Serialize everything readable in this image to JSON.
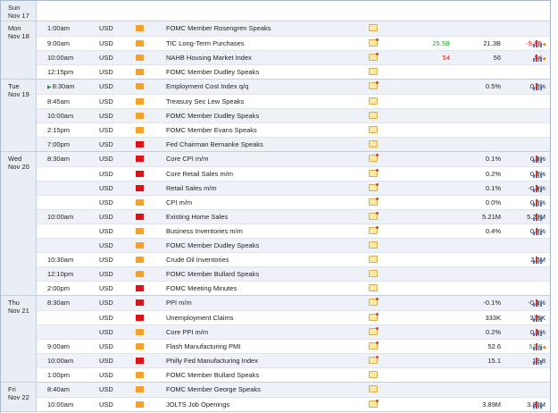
{
  "calendar": {
    "groups": [
      {
        "day": [
          "Sun",
          "Nov 17"
        ],
        "rows": []
      },
      {
        "day": [
          "Mon",
          "Nov 18"
        ],
        "rows": [
          {
            "time": "1:00am",
            "cur": "USD",
            "imp": "low",
            "event": "FOMC Member Rosengren Speaks",
            "doc": "plain",
            "actual": "",
            "actual_color": "",
            "forecast": "",
            "previous": "",
            "prev_color": "",
            "prev_mark": "",
            "chart": false
          },
          {
            "time": "9:00am",
            "cur": "USD",
            "imp": "low",
            "event": "TIC Long-Term Purchases",
            "doc": "star",
            "actual": "25.5B",
            "actual_color": "g",
            "forecast": "21.3B",
            "previous": "-9.8B",
            "prev_color": "r",
            "prev_mark": "◀",
            "chart": true
          },
          {
            "time": "10:00am",
            "cur": "USD",
            "imp": "low",
            "event": "NAHB Housing Market Index",
            "doc": "star",
            "actual": "54",
            "actual_color": "r",
            "forecast": "56",
            "previous": "54",
            "prev_color": "r",
            "prev_mark": "◀",
            "chart": true
          },
          {
            "time": "12:15pm",
            "cur": "USD",
            "imp": "low",
            "event": "FOMC Member Dudley Speaks",
            "doc": "plain",
            "actual": "",
            "actual_color": "",
            "forecast": "",
            "previous": "",
            "prev_color": "",
            "prev_mark": "",
            "chart": false
          }
        ]
      },
      {
        "day": [
          "Tue",
          "Nov 19"
        ],
        "rows": [
          {
            "time": "8:30am",
            "live": true,
            "cur": "USD",
            "imp": "low",
            "event": "Employment Cost Index q/q",
            "doc": "star",
            "actual": "",
            "actual_color": "",
            "forecast": "0.5%",
            "previous": "0.5%",
            "prev_color": "",
            "prev_mark": "",
            "chart": true
          },
          {
            "time": "8:45am",
            "cur": "USD",
            "imp": "low",
            "event": "Treasury Sec Lew Speaks",
            "doc": "plain",
            "actual": "",
            "actual_color": "",
            "forecast": "",
            "previous": "",
            "prev_color": "",
            "prev_mark": "",
            "chart": false
          },
          {
            "time": "10:00am",
            "cur": "USD",
            "imp": "low",
            "event": "FOMC Member Dudley Speaks",
            "doc": "plain",
            "actual": "",
            "actual_color": "",
            "forecast": "",
            "previous": "",
            "prev_color": "",
            "prev_mark": "",
            "chart": false
          },
          {
            "time": "2:15pm",
            "cur": "USD",
            "imp": "low",
            "event": "FOMC Member Evans Speaks",
            "doc": "plain",
            "actual": "",
            "actual_color": "",
            "forecast": "",
            "previous": "",
            "prev_color": "",
            "prev_mark": "",
            "chart": false
          },
          {
            "time": "7:00pm",
            "cur": "USD",
            "imp": "high",
            "event": "Fed Chairman Bernanke Speaks",
            "doc": "plain",
            "actual": "",
            "actual_color": "",
            "forecast": "",
            "previous": "",
            "prev_color": "",
            "prev_mark": "",
            "chart": false
          }
        ]
      },
      {
        "day": [
          "Wed",
          "Nov 20"
        ],
        "rows": [
          {
            "time": "8:30am",
            "cur": "USD",
            "imp": "high",
            "event": "Core CPI m/m",
            "doc": "star",
            "actual": "",
            "actual_color": "",
            "forecast": "0.1%",
            "previous": "0.1%",
            "prev_color": "",
            "prev_mark": "",
            "chart": true
          },
          {
            "time": "",
            "cur": "USD",
            "imp": "high",
            "event": "Core Retail Sales m/m",
            "doc": "star",
            "actual": "",
            "actual_color": "",
            "forecast": "0.2%",
            "previous": "0.4%",
            "prev_color": "",
            "prev_mark": "",
            "chart": true
          },
          {
            "time": "",
            "cur": "USD",
            "imp": "high",
            "event": "Retail Sales m/m",
            "doc": "star",
            "actual": "",
            "actual_color": "",
            "forecast": "0.1%",
            "previous": "-0.1%",
            "prev_color": "",
            "prev_mark": "",
            "chart": true
          },
          {
            "time": "",
            "cur": "USD",
            "imp": "low",
            "event": "CPI m/m",
            "doc": "star",
            "actual": "",
            "actual_color": "",
            "forecast": "0.0%",
            "previous": "0.2%",
            "prev_color": "",
            "prev_mark": "",
            "chart": true
          },
          {
            "time": "10:00am",
            "cur": "USD",
            "imp": "high",
            "event": "Existing Home Sales",
            "doc": "star",
            "actual": "",
            "actual_color": "",
            "forecast": "5.21M",
            "previous": "5.29M",
            "prev_color": "",
            "prev_mark": "",
            "chart": true
          },
          {
            "time": "",
            "cur": "USD",
            "imp": "low",
            "event": "Business Inventories m/m",
            "doc": "star",
            "actual": "",
            "actual_color": "",
            "forecast": "0.4%",
            "previous": "0.3%",
            "prev_color": "",
            "prev_mark": "",
            "chart": true
          },
          {
            "time": "",
            "cur": "USD",
            "imp": "low",
            "event": "FOMC Member Dudley Speaks",
            "doc": "plain",
            "actual": "",
            "actual_color": "",
            "forecast": "",
            "previous": "",
            "prev_color": "",
            "prev_mark": "",
            "chart": false
          },
          {
            "time": "10:30am",
            "cur": "USD",
            "imp": "low",
            "event": "Crude Oil Inventories",
            "doc": "plain",
            "actual": "",
            "actual_color": "",
            "forecast": "",
            "previous": "2.6M",
            "prev_color": "",
            "prev_mark": "",
            "chart": true
          },
          {
            "time": "12:10pm",
            "cur": "USD",
            "imp": "low",
            "event": "FOMC Member Bullard Speaks",
            "doc": "plain",
            "actual": "",
            "actual_color": "",
            "forecast": "",
            "previous": "",
            "prev_color": "",
            "prev_mark": "",
            "chart": false
          },
          {
            "time": "2:00pm",
            "cur": "USD",
            "imp": "high",
            "event": "FOMC Meeting Minutes",
            "doc": "plain",
            "actual": "",
            "actual_color": "",
            "forecast": "",
            "previous": "",
            "prev_color": "",
            "prev_mark": "",
            "chart": false
          }
        ]
      },
      {
        "day": [
          "Thu",
          "Nov 21"
        ],
        "rows": [
          {
            "time": "8:30am",
            "cur": "USD",
            "imp": "high",
            "event": "PPI m/m",
            "doc": "star",
            "actual": "",
            "actual_color": "",
            "forecast": "-0.1%",
            "previous": "-0.1%",
            "prev_color": "",
            "prev_mark": "",
            "chart": true
          },
          {
            "time": "",
            "cur": "USD",
            "imp": "high",
            "event": "Unemployment Claims",
            "doc": "star",
            "actual": "",
            "actual_color": "",
            "forecast": "333K",
            "previous": "339K",
            "prev_color": "",
            "prev_mark": "",
            "chart": true
          },
          {
            "time": "",
            "cur": "USD",
            "imp": "low",
            "event": "Core PPI m/m",
            "doc": "star",
            "actual": "",
            "actual_color": "",
            "forecast": "0.2%",
            "previous": "0.1%",
            "prev_color": "",
            "prev_mark": "",
            "chart": true
          },
          {
            "time": "9:00am",
            "cur": "USD",
            "imp": "low",
            "event": "Flash Manufacturing PMI",
            "doc": "star",
            "actual": "",
            "actual_color": "",
            "forecast": "52.6",
            "previous": "51.8",
            "prev_color": "g",
            "prev_mark": "◀",
            "chart": true
          },
          {
            "time": "10:00am",
            "cur": "USD",
            "imp": "high",
            "event": "Philly Fed Manufacturing Index",
            "doc": "star",
            "actual": "",
            "actual_color": "",
            "forecast": "15.1",
            "previous": "19.8",
            "prev_color": "",
            "prev_mark": "",
            "chart": true
          },
          {
            "time": "1:00pm",
            "cur": "USD",
            "imp": "low",
            "event": "FOMC Member Bullard Speaks",
            "doc": "plain",
            "actual": "",
            "actual_color": "",
            "forecast": "",
            "previous": "",
            "prev_color": "",
            "prev_mark": "",
            "chart": false
          }
        ]
      },
      {
        "day": [
          "Fri",
          "Nov 22"
        ],
        "rows": [
          {
            "time": "8:40am",
            "cur": "USD",
            "imp": "low",
            "event": "FOMC Member George Speaks",
            "doc": "plain",
            "actual": "",
            "actual_color": "",
            "forecast": "",
            "previous": "",
            "prev_color": "",
            "prev_mark": "",
            "chart": false
          },
          {
            "time": "10:00am",
            "cur": "USD",
            "imp": "low",
            "event": "JOLTS Job Openings",
            "doc": "star",
            "actual": "",
            "actual_color": "",
            "forecast": "3.89M",
            "previous": "3.88M",
            "prev_color": "",
            "prev_mark": "",
            "chart": true
          }
        ]
      }
    ]
  }
}
